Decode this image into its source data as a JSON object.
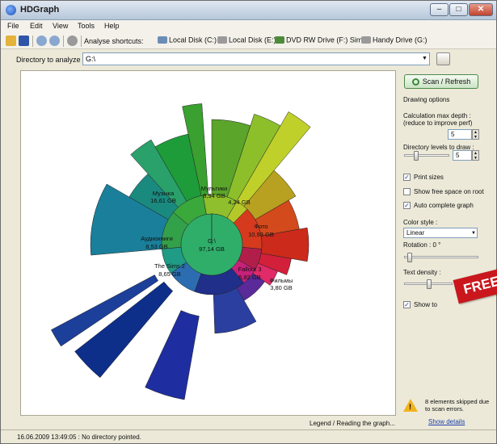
{
  "window": {
    "title": "HDGraph"
  },
  "menu": [
    "File",
    "Edit",
    "View",
    "Tools",
    "Help"
  ],
  "toolbar": {
    "analyse_label": "Analyse shortcuts:",
    "drives": [
      {
        "label": "Local Disk (C:)",
        "icon": "hard-disk-icon",
        "color": "#6b8db5"
      },
      {
        "label": "Local Disk (E:)",
        "icon": "hard-disk-icon",
        "color": "#9a9a9a"
      },
      {
        "label": "DVD RW Drive (F:) Sims3",
        "icon": "dvd-drive-icon",
        "color": "#4d8a3a"
      },
      {
        "label": "Handy Drive (G:)",
        "icon": "usb-drive-icon",
        "color": "#9a9a9a"
      }
    ]
  },
  "directory": {
    "label": "Directory to analyze :",
    "value": "G:\\"
  },
  "chart": {
    "center_label": "G:\\",
    "center_size": "97,14 GB",
    "segments": [
      {
        "name": "Музыка",
        "size": "16,61 GB",
        "color": "#2f9a3c"
      },
      {
        "name": "Мультики",
        "size": "8,94 GB",
        "color": "#8bbf2b"
      },
      {
        "name": "Фото",
        "size": "10,93 GB",
        "color": "#d63a1e"
      },
      {
        "name": "Аудиокниги",
        "size": "8,53 GB",
        "color": "#1f9b86"
      },
      {
        "name": "The Sims 2",
        "size": "8,65 GB",
        "color": "#2b6db0"
      },
      {
        "name": "Fallout 3",
        "size": "5,82 GB",
        "color": "#b11e4a"
      },
      {
        "name": "Фильмы",
        "size": "3,80 GB",
        "color": "#c8217a"
      }
    ]
  },
  "legend_link": "Legend / Reading the graph...",
  "panel": {
    "scan_button": "Scan / Refresh",
    "drawing_options": "Drawing options",
    "calc_depth_label": "Calculation max depth : (reduce to improve perf)",
    "calc_depth_value": "5",
    "levels_label": "Directory levels to draw :",
    "levels_value": "5",
    "print_sizes": "Print sizes",
    "show_free": "Show free space on root",
    "auto_complete": "Auto complete graph",
    "color_style_label": "Color style :",
    "color_style_value": "Linear",
    "rotation_label": "Rotation : 0 °",
    "text_density_label": "Text density :",
    "show_tooltips": "Show to",
    "warning": "8 elements skipped due to scan errors.",
    "show_details": "Show details"
  },
  "status": "16.06.2009 13:49:05 : No directory pointed.",
  "badge": "FREE"
}
